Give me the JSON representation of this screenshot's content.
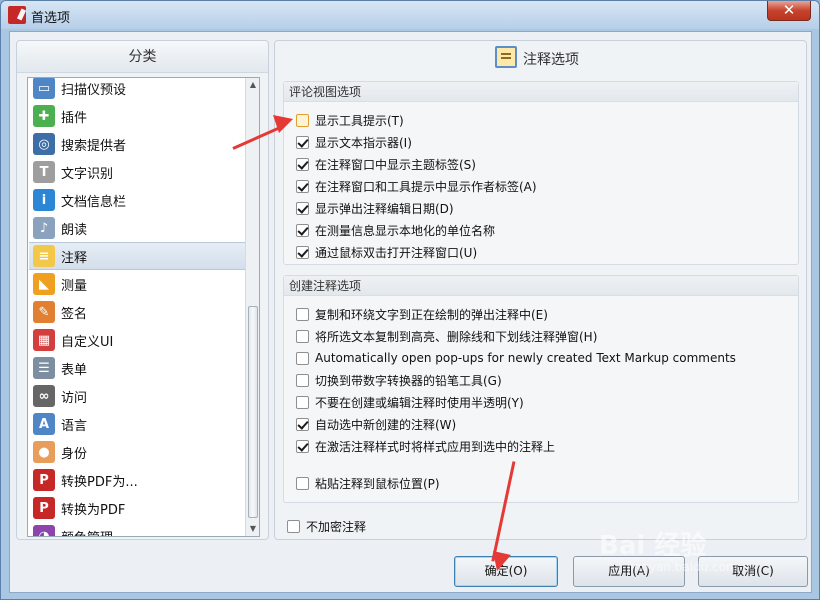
{
  "window": {
    "title": "首选项",
    "close_glyph": "✕"
  },
  "left": {
    "header": "分类",
    "items": [
      {
        "label": "扫描仪预设",
        "icon": "scanner-icon",
        "color": "#4f86c6"
      },
      {
        "label": "插件",
        "icon": "puzzle-icon",
        "color": "#4caf50"
      },
      {
        "label": "搜索提供者",
        "icon": "binoculars-icon",
        "color": "#3d6ea8"
      },
      {
        "label": "文字识别",
        "icon": "ocr-icon",
        "color": "#9e9e9e"
      },
      {
        "label": "文档信息栏",
        "icon": "info-icon",
        "color": "#2b86d6"
      },
      {
        "label": "朗读",
        "icon": "speaker-icon",
        "color": "#8aa2bd"
      },
      {
        "label": "注释",
        "icon": "comment-icon",
        "color": "#f3c84a"
      },
      {
        "label": "测量",
        "icon": "ruler-icon",
        "color": "#f0a020"
      },
      {
        "label": "签名",
        "icon": "signature-icon",
        "color": "#e08030"
      },
      {
        "label": "自定义UI",
        "icon": "palette-icon",
        "color": "#d33f3f"
      },
      {
        "label": "表单",
        "icon": "form-icon",
        "color": "#7d8ea0"
      },
      {
        "label": "访问",
        "icon": "glasses-icon",
        "color": "#666666"
      },
      {
        "label": "语言",
        "icon": "language-icon",
        "color": "#4f86c6"
      },
      {
        "label": "身份",
        "icon": "person-icon",
        "color": "#e89e5a"
      },
      {
        "label": "转换PDF为...",
        "icon": "pdf-export-icon",
        "color": "#c62828"
      },
      {
        "label": "转换为PDF",
        "icon": "pdf-import-icon",
        "color": "#c62828"
      },
      {
        "label": "颜色管理",
        "icon": "color-wheel-icon",
        "color": "#8e44ad"
      }
    ],
    "selected_index": 6
  },
  "right": {
    "header": "注释选项",
    "review_group": {
      "title": "评论视图选项",
      "options": [
        {
          "label": "显示工具提示(T)",
          "checked": false,
          "highlight": true
        },
        {
          "label": "显示文本指示器(I)",
          "checked": true
        },
        {
          "label": "在注释窗口中显示主题标签(S)",
          "checked": true
        },
        {
          "label": "在注释窗口和工具提示中显示作者标签(A)",
          "checked": true
        },
        {
          "label": "显示弹出注释编辑日期(D)",
          "checked": true
        },
        {
          "label": "在测量信息显示本地化的单位名称",
          "checked": true
        },
        {
          "label": "通过鼠标双击打开注释窗口(U)",
          "checked": true
        }
      ]
    },
    "create_group": {
      "title": "创建注释选项",
      "options": [
        {
          "label": "复制和环绕文字到正在绘制的弹出注释中(E)",
          "checked": false
        },
        {
          "label": "将所选文本复制到高亮、删除线和下划线注释弹窗(H)",
          "checked": false
        },
        {
          "label": "Automatically open pop-ups for newly created Text Markup comments",
          "checked": false
        },
        {
          "label": "切换到带数字转换器的铅笔工具(G)",
          "checked": false
        },
        {
          "label": "不要在创建或编辑注释时使用半透明(Y)",
          "checked": false
        },
        {
          "label": "自动选中新创建的注释(W)",
          "checked": true
        },
        {
          "label": "在激活注释样式时将样式应用到选中的注释上",
          "checked": true
        },
        {
          "label": "粘贴注释到鼠标位置(P)",
          "checked": false
        }
      ]
    },
    "no_encrypt": {
      "label": "不加密注释",
      "checked": false
    }
  },
  "buttons": {
    "ok": "确定(O)",
    "apply": "应用(A)",
    "cancel": "取消(C)"
  },
  "watermark": {
    "brand": "Bai 经验",
    "url": "jingyan.baidu.com"
  },
  "annotation_color": "#e53935"
}
